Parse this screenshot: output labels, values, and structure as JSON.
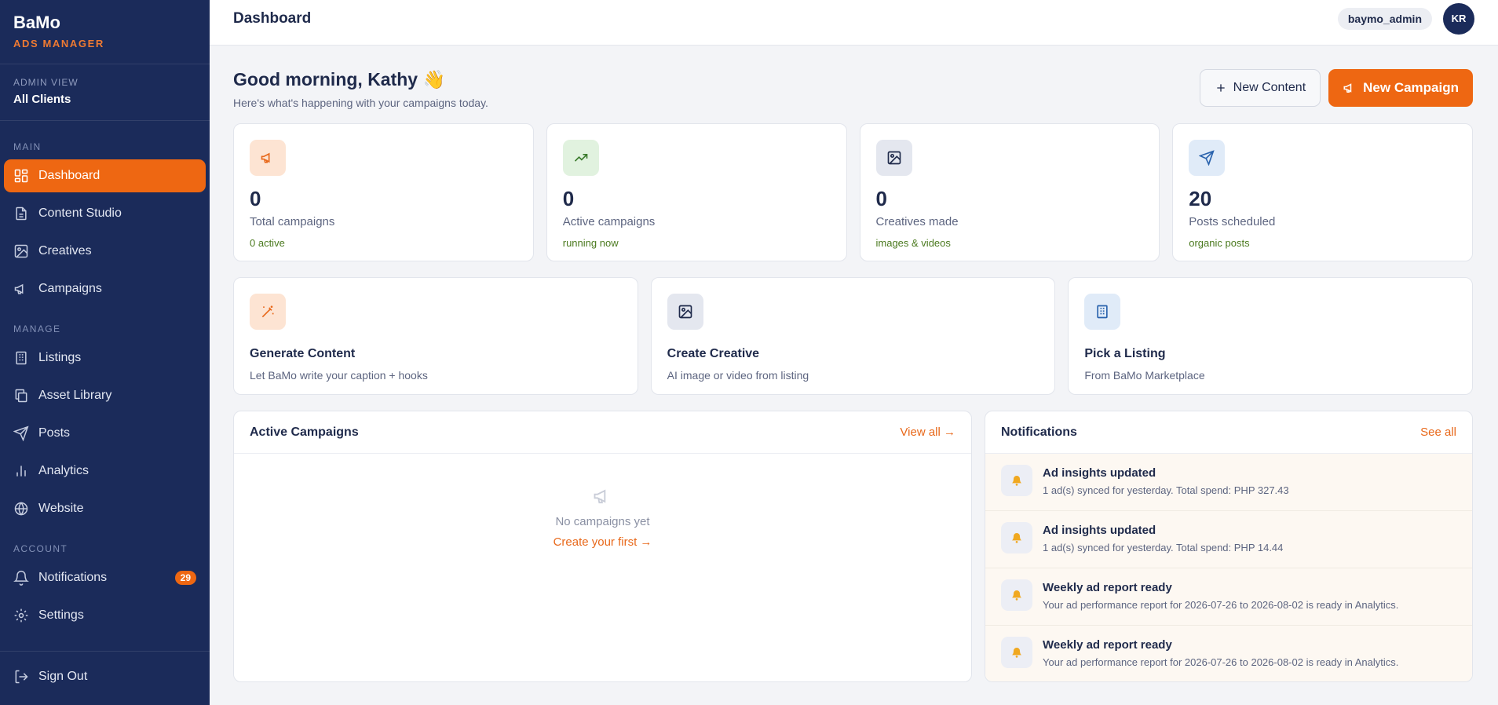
{
  "brand": {
    "name": "BaMo",
    "sub": "ADS MANAGER"
  },
  "admin": {
    "label": "ADMIN VIEW",
    "value": "All Clients"
  },
  "nav": {
    "section_main": "MAIN",
    "section_manage": "MANAGE",
    "section_account": "ACCOUNT",
    "dashboard": "Dashboard",
    "content_studio": "Content Studio",
    "creatives": "Creatives",
    "campaigns": "Campaigns",
    "listings": "Listings",
    "asset_library": "Asset Library",
    "posts": "Posts",
    "analytics": "Analytics",
    "website": "Website",
    "notifications": "Notifications",
    "notifications_badge": "29",
    "settings": "Settings",
    "sign_out": "Sign Out"
  },
  "header": {
    "title": "Dashboard",
    "user": "baymo_admin",
    "avatar": "KR"
  },
  "greeting": {
    "title": "Good morning, Kathy 👋",
    "subtitle": "Here's what's happening with your campaigns today."
  },
  "actions": {
    "new_content": "New Content",
    "new_campaign": "New Campaign"
  },
  "stats": [
    {
      "value": "0",
      "label": "Total campaigns",
      "sub": "0 active"
    },
    {
      "value": "0",
      "label": "Active campaigns",
      "sub": "running now"
    },
    {
      "value": "0",
      "label": "Creatives made",
      "sub": "images & videos"
    },
    {
      "value": "20",
      "label": "Posts scheduled",
      "sub": "organic posts"
    }
  ],
  "quick": [
    {
      "title": "Generate Content",
      "sub": "Let BaMo write your caption + hooks"
    },
    {
      "title": "Create Creative",
      "sub": "AI image or video from listing"
    },
    {
      "title": "Pick a Listing",
      "sub": "From BaMo Marketplace"
    }
  ],
  "active_campaigns": {
    "title": "Active Campaigns",
    "link": "View all →",
    "empty": "No campaigns yet",
    "cta": "Create your first →"
  },
  "notifications": {
    "title": "Notifications",
    "link": "See all",
    "items": [
      {
        "title": "Ad insights updated",
        "text": "1 ad(s) synced for yesterday. Total spend: PHP 327.43"
      },
      {
        "title": "Ad insights updated",
        "text": "1 ad(s) synced for yesterday. Total spend: PHP 14.44"
      },
      {
        "title": "Weekly ad report ready",
        "text": "Your ad performance report for 2026-07-26 to 2026-08-02 is ready in Analytics."
      },
      {
        "title": "Weekly ad report ready",
        "text": "Your ad performance report for 2026-07-26 to 2026-08-02 is ready in Analytics."
      }
    ]
  },
  "colors": {
    "sidebar": "#1b2b5a",
    "accent": "#ee6712",
    "positive": "#4b7a1f"
  }
}
